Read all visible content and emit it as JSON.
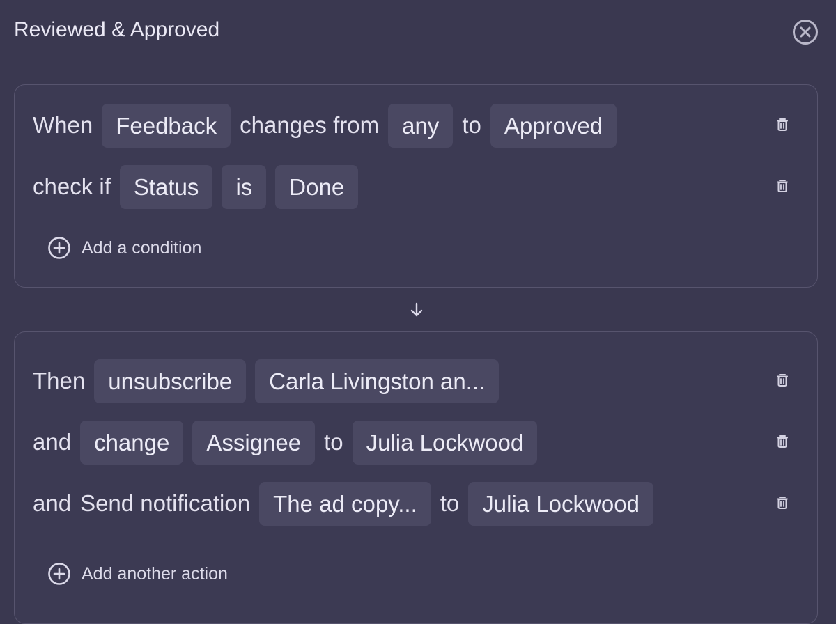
{
  "dialog": {
    "title": "Reviewed & Approved"
  },
  "trigger": {
    "row1": {
      "prefix": "When",
      "field": "Feedback",
      "connector1": "changes from",
      "from_value": "any",
      "connector2": "to",
      "to_value": "Approved"
    },
    "row2": {
      "prefix": "check if",
      "field": "Status",
      "operator": "is",
      "value": "Done"
    },
    "add_condition_label": "Add a condition"
  },
  "actions": {
    "row1": {
      "prefix": "Then",
      "action": "unsubscribe",
      "target": "Carla Livingston an..."
    },
    "row2": {
      "prefix": "and",
      "action": "change",
      "field": "Assignee",
      "connector": "to",
      "value": "Julia Lockwood"
    },
    "row3": {
      "prefix": "and",
      "action": "Send notification",
      "message": "The ad copy...",
      "connector": "to",
      "recipient": "Julia Lockwood"
    },
    "add_action_label": "Add another action"
  },
  "icons": {
    "close": "close-circle-icon",
    "delete": "trash-icon",
    "add": "plus-circle-icon",
    "flow": "arrow-down-icon"
  },
  "colors": {
    "background": "#3a3850",
    "chip": "#4a4862",
    "card_border": "#57546e",
    "text": "#e7e5f2"
  }
}
